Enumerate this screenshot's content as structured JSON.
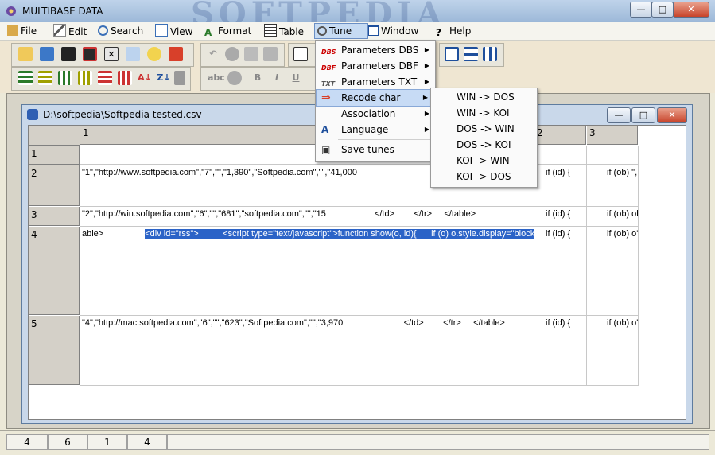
{
  "app": {
    "title": "MULTIBASE DATA",
    "watermark": "SOFTPEDIA",
    "window_buttons": [
      "—",
      "□",
      "✕"
    ]
  },
  "menubar": [
    "File",
    "Edit",
    "Search",
    "View",
    "Format",
    "Table",
    "Tune",
    "Window",
    "Help"
  ],
  "toolbar": {
    "row1": [
      "new-icon",
      "open-icon",
      "save-icon",
      "save-as-icon",
      "close-file-icon",
      "print-icon",
      "wizard-icon",
      "stop-icon",
      "undo-icon",
      "cut-icon",
      "copy-icon",
      "paste-icon",
      "copy-grid-icon",
      "paste-grid-icon",
      "cascade-icon",
      "tile-horizontal-icon",
      "tile-vertical-icon"
    ],
    "row2": [
      "row-icon",
      "insert-row-icon",
      "delete-row-icon",
      "insert-col-icon",
      "delete-col-icon",
      "sort-asc-icon",
      "sort-desc-icon",
      "filter-icon",
      "spell-icon",
      "paint-icon",
      "bold-icon",
      "italic-icon",
      "underline-icon",
      "align-icon"
    ],
    "row2_text": {
      "bold": "B",
      "italic": "I",
      "underline": "U"
    }
  },
  "document": {
    "title": "D:\\softpedia\\Softpedia tested.csv",
    "window_buttons": [
      "—",
      "□",
      "✕"
    ]
  },
  "grid": {
    "col_headers": [
      "1",
      "2",
      "3"
    ],
    "rows": [
      {
        "num": "1",
        "c1": "",
        "c2": "",
        "c3": ""
      },
      {
        "num": "2",
        "c1": "\"1\",\"http://www.softpedia.com\",\"7\",\"\",\"1,390\",\"Softpedia.com\",\"\",\"41,000",
        "c2": "if (id) {",
        "c3": "if (ob) \","
      },
      {
        "num": "3",
        "c1": "\"2\",\"http://win.softpedia.com\",\"6\",\"\",\"681\",\"softpedia.com\",\"\",\"15                    </td>        </tr>     </table>",
        "c2": "if (id) {",
        "c3": "if (ob) ob"
      },
      {
        "num": "4",
        "c1_prefix": "able>",
        "c1_selected": "<div id=\"rss\">          <script type=\"text/javascript\">function show(o, id){      if (o) o.style.display=\"block\"",
        "c2": "if (id) {",
        "c3": "if (ob) o'"
      },
      {
        "num": "5",
        "c1": "\"4\",\"http://mac.softpedia.com\",\"6\",\"\",\"623\",\"Softpedia.com\",\"\",\"3,970                         </td>        </tr>     </table>",
        "c2": "if (id) {",
        "c3": "if (ob) o'"
      }
    ]
  },
  "tune_menu": [
    {
      "label": "Parameters DBS",
      "icon": "DBS",
      "arrow": "▶"
    },
    {
      "label": "Parameters DBF",
      "icon": "DBF",
      "arrow": "▶"
    },
    {
      "label": "Parameters TXT",
      "icon": "TXT",
      "arrow": "▶"
    },
    {
      "label": "Recode char",
      "icon": "⇒",
      "arrow": "▶"
    },
    {
      "label": "Association",
      "icon": "",
      "arrow": "▶"
    },
    {
      "label": "Language",
      "icon": "A",
      "arrow": "▶"
    },
    {
      "label": "Save tunes",
      "icon": "▣",
      "arrow": ""
    }
  ],
  "recode_submenu": [
    "WIN -> DOS",
    "WIN -> KOI",
    "DOS -> WIN",
    "DOS -> KOI",
    "KOI -> WIN",
    "KOI -> DOS"
  ],
  "status": [
    "4",
    "6",
    "1",
    "4"
  ],
  "colors": {
    "selection": "#2b63c7",
    "menu_highlight": "#c7dbf5"
  }
}
